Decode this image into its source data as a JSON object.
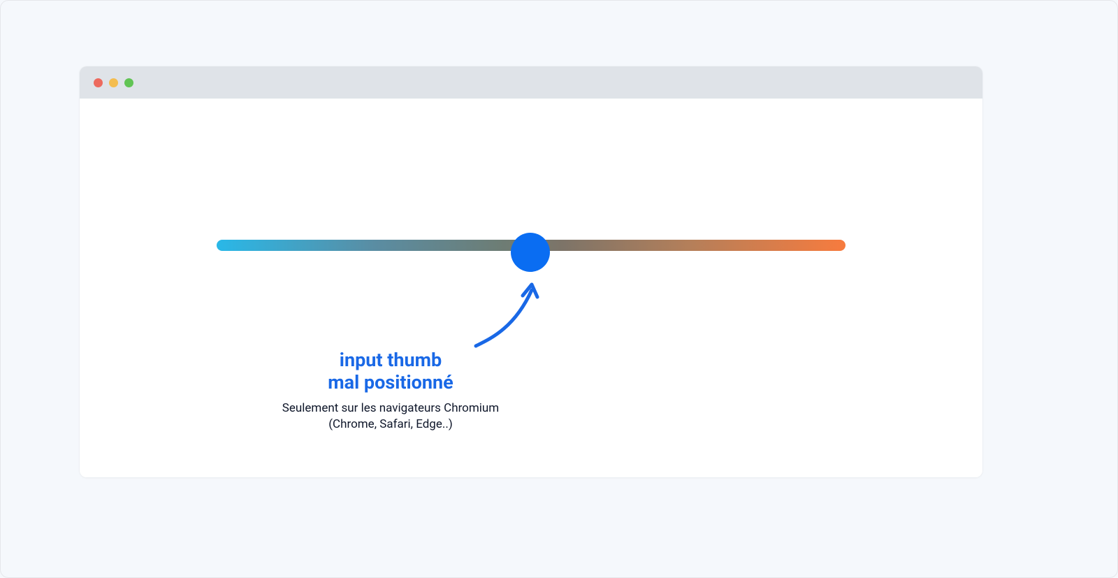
{
  "annotation": {
    "title_line1": "input thumb",
    "title_line2": "mal positionné",
    "subtitle_line1": "Seulement sur les navigateurs Chromium",
    "subtitle_line2": "(Chrome, Safari, Edge..)"
  },
  "colors": {
    "accent_blue": "#1968e6",
    "thumb_blue": "#0a6df2",
    "track_start": "#29b8e8",
    "track_end": "#f77b3e",
    "titlebar": "#dfe3e8",
    "page_bg": "#f5f8fc",
    "traffic_red": "#ed6a5e",
    "traffic_yellow": "#f4bd4f",
    "traffic_green": "#61c454"
  },
  "slider": {
    "thumb_position_percent": 50
  }
}
